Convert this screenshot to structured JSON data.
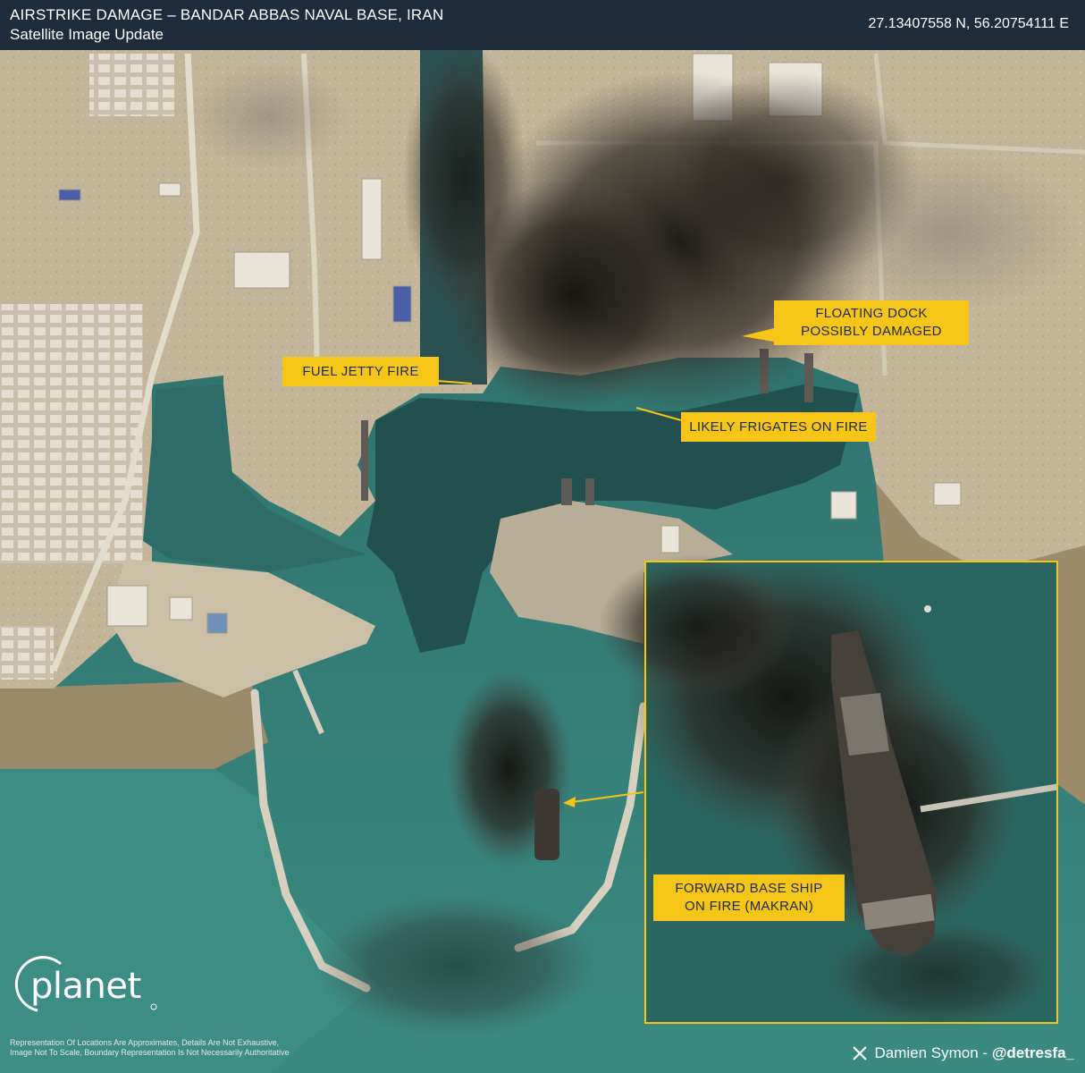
{
  "header": {
    "title": "AIRSTRIKE DAMAGE – BANDAR ABBAS NAVAL BASE, IRAN",
    "subtitle": "Satellite Image Update",
    "coordinates": "27.13407558 N, 56.20754111 E"
  },
  "callouts": {
    "floating_dock": [
      "FLOATING DOCK",
      "POSSIBLY DAMAGED"
    ],
    "fuel_jetty": "FUEL JETTY FIRE",
    "frigates": "LIKELY FRIGATES ON FIRE",
    "forward_base_ship": [
      "FORWARD BASE SHIP",
      "ON FIRE (MAKRAN)"
    ]
  },
  "branding": {
    "logo_text": "planet",
    "credit_name": "Damien Symon - ",
    "credit_handle": "@detresfa_"
  },
  "disclaimer": [
    "Representation Of Locations Are Approximates, Details Are Not Exhaustive,",
    "Image Not To Scale, Boundary Representation Is Not Necessarily Authoritative"
  ],
  "colors": {
    "callout": "#f5c518",
    "header": "#1d2b3a",
    "water": "#2f6f6a",
    "land": "#bfb39a",
    "smoke": "#1f1c1a"
  }
}
